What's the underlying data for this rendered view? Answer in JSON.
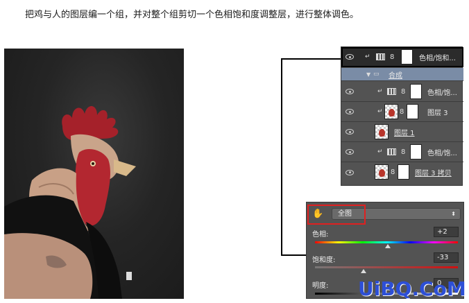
{
  "instruction": "把鸡与人的图层编一个组，并对整个组剪切一个色相饱和度调整层，进行整体调色。",
  "layers": {
    "rows": [
      {
        "name": "色相/饱和..."
      },
      {
        "name": "合成"
      },
      {
        "name": "色相/饱..."
      },
      {
        "name": "图层 3"
      },
      {
        "name": "图层 1"
      },
      {
        "name": "色相/饱..."
      },
      {
        "name": "图层 3 拷贝"
      }
    ]
  },
  "hue_sat": {
    "preset": "全图",
    "hue_label": "色相:",
    "hue_value": "+2",
    "hue_fraction": 0.51,
    "sat_label": "饱和度:",
    "sat_value": "-33",
    "sat_fraction": 0.34,
    "light_label": "明度:",
    "light_value": "0"
  },
  "watermark": "UiBQ.CoM",
  "colors": {
    "panel_bg": "#535353",
    "group_row": "#7a8ca6",
    "highlight_border": "#e02020",
    "watermark": "#2d4fd6"
  }
}
